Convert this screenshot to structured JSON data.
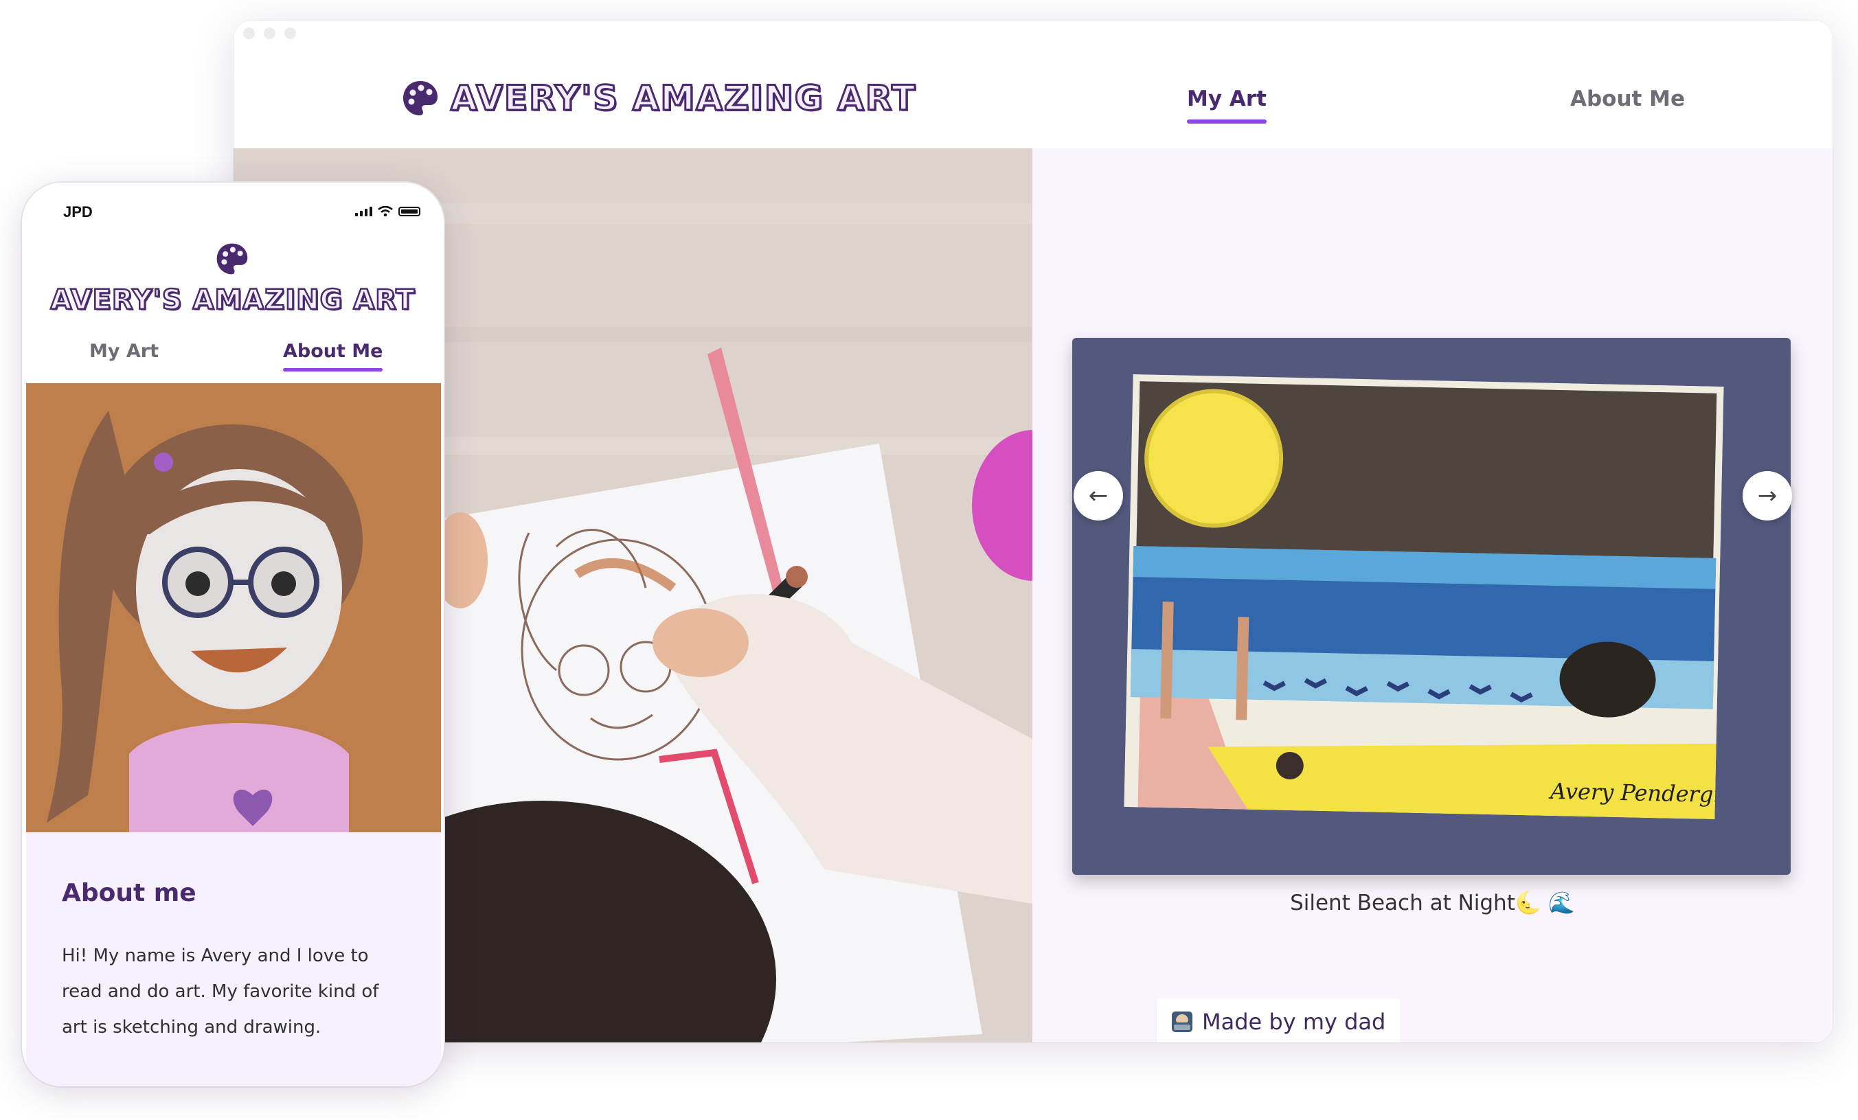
{
  "desktop": {
    "brand_title": "AVERY'S AMAZING ART",
    "nav": {
      "my_art": "My Art",
      "about_me": "About Me"
    },
    "gallery": {
      "caption": "Silent Beach at Night🌜 🌊",
      "prev_icon": "←",
      "next_icon": "→"
    },
    "footer_badge": "Made by my dad"
  },
  "mobile": {
    "carrier": "JPD",
    "brand_title": "AVERY'S AMAZING ART",
    "nav": {
      "my_art": "My Art",
      "about_me": "About Me"
    },
    "about": {
      "heading": "About me",
      "body": "Hi! My name is Avery and I love to read and do art. My favorite kind of art is sketching and drawing."
    }
  },
  "artwork": {
    "signature": "Avery Pendergraft"
  },
  "colors": {
    "brand_purple": "#4a2a6e",
    "accent_purple": "#8e44e4",
    "panel_lavender": "#faf4fe",
    "frame_navy": "#53597d"
  },
  "icons": [
    "palette-icon",
    "arrow-left-icon",
    "arrow-right-icon",
    "developer-emoji-icon",
    "signal-icon",
    "wifi-icon",
    "battery-icon"
  ]
}
